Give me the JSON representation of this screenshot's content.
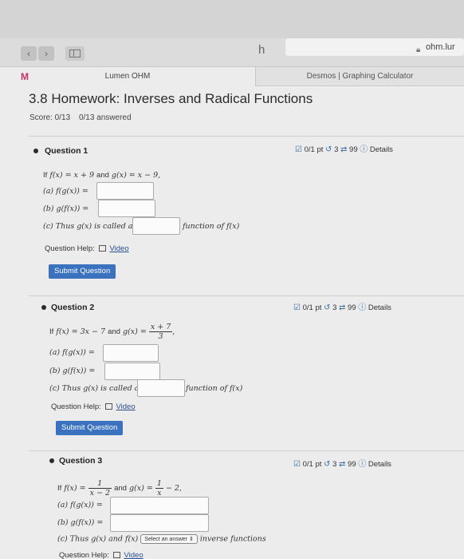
{
  "browser": {
    "url": "ohm.lur",
    "extension_icon": "h"
  },
  "tabs": {
    "active": "Lumen OHM",
    "inactive": "Desmos | Graphing Calculator"
  },
  "page": {
    "title": "3.8 Homework: Inverses and Radical Functions",
    "score_label": "Score: 0/13",
    "answered": "0/13 answered"
  },
  "questions": [
    {
      "title": "Question 1",
      "points": "0/1 pt",
      "attempts": "3",
      "versions": "99",
      "details": "Details",
      "prompt_if": "If",
      "f_def": "f(x) = x + 9",
      "and": "and",
      "g_def": "g(x) = x − 9,",
      "a_label": "(a) f(g(x)) =",
      "b_label": "(b) g(f(x)) =",
      "c_prefix": "(c) Thus g(x) is called an",
      "c_suffix": "function of f(x)",
      "help_label": "Question Help:",
      "video_label": "Video",
      "submit_label": "Submit Question"
    },
    {
      "title": "Question 2",
      "points": "0/1 pt",
      "attempts": "3",
      "versions": "99",
      "details": "Details",
      "prompt_if": "If",
      "f_def": "f(x) = 3x − 7",
      "and": "and",
      "g_lhs": "g(x) =",
      "g_num": "x + 7",
      "g_den": "3",
      "g_tail": ",",
      "a_label": "(a) f(g(x)) =",
      "b_label": "(b) g(f(x)) =",
      "c_prefix": "(c) Thus g(x) is called an",
      "c_suffix": "function of f(x)",
      "help_label": "Question Help:",
      "video_label": "Video",
      "submit_label": "Submit Question"
    },
    {
      "title": "Question 3",
      "points": "0/1 pt",
      "attempts": "3",
      "versions": "99",
      "details": "Details",
      "prompt_if": "If",
      "f_lhs": "f(x) =",
      "f_num": "1",
      "f_den": "x − 2",
      "and": "and",
      "g_lhs": "g(x) =",
      "g_num": "1",
      "g_den": "x",
      "g_tail": "− 2,",
      "a_label": "(a) f(g(x)) =",
      "b_label": "(b) g(f(x)) =",
      "c_prefix": "(c) Thus g(x) and f(x)",
      "select_value": "Select an answer",
      "c_suffix": "inverse functions",
      "help_label": "Question Help:",
      "video_label": "Video"
    }
  ]
}
